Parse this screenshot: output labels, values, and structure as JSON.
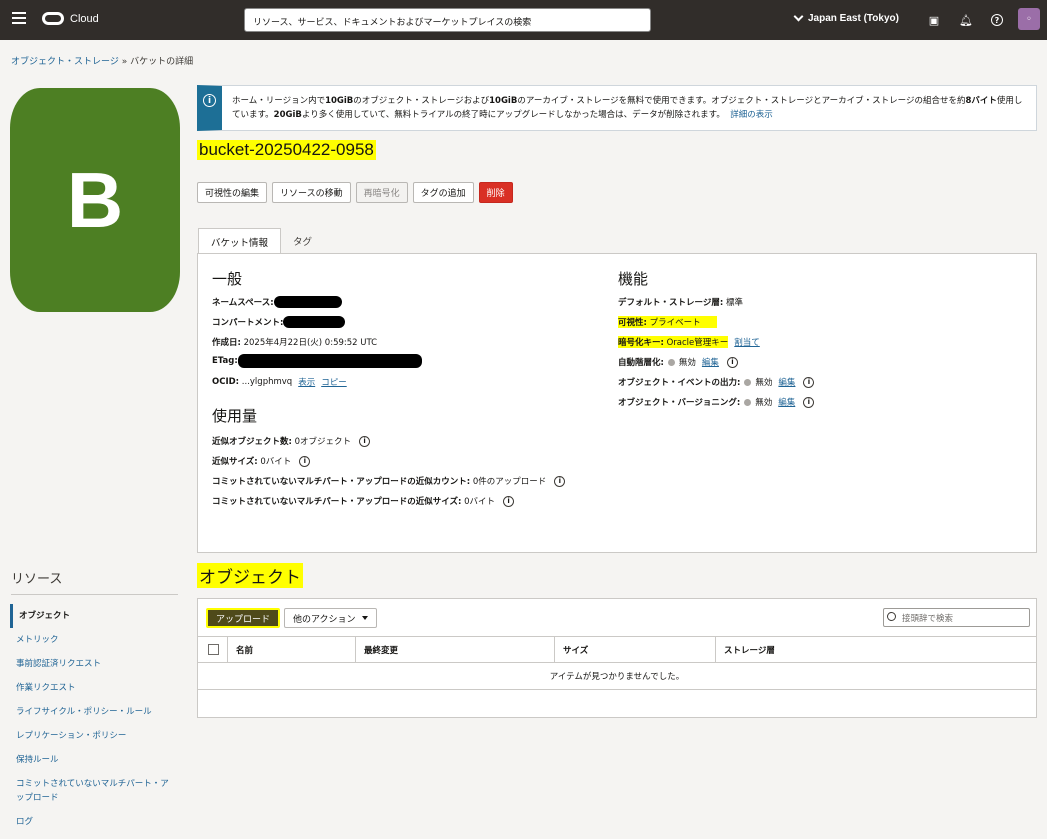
{
  "topbar": {
    "brand": "Cloud",
    "search_placeholder": "リソース、サービス、ドキュメントおよびマーケットプレイスの検索",
    "region": "Japan East (Tokyo)"
  },
  "breadcrumb": {
    "parent": "オブジェクト・ストレージ",
    "separator": "»",
    "current": "バケットの詳細"
  },
  "bucket_icon_letter": "B",
  "banner": {
    "text1": "ホーム・リージョン内で",
    "b1": "10GiB",
    "text2": "のオブジェクト・ストレージおよび",
    "b2": "10GiB",
    "text3": "のアーカイブ・ストレージを無料で使用できます。オブジェクト・ストレージとアーカイブ・ストレージの組合せを約",
    "b3": "8バイト",
    "text4": "使用しています。",
    "b4": "20GiB",
    "text5": "より多く使用していて、無料トライアルの終了時にアップグレードしなかった場合は、データが削除されます。",
    "link": "詳細の表示"
  },
  "title": "bucket-20250422-0958",
  "buttons": {
    "edit_visibility": "可視性の編集",
    "move_resource": "リソースの移動",
    "reencrypt": "再暗号化",
    "add_tags": "タグの追加",
    "delete": "削除"
  },
  "tabs": {
    "bucket_info": "バケット情報",
    "tags": "タグ"
  },
  "general": {
    "heading": "一般",
    "namespace_label": "ネームスペース:",
    "compartment_label": "コンパートメント:",
    "created_label": "作成日:",
    "created_value": "2025年4月22日(火) 0:59:52 UTC",
    "etag_label": "ETag:",
    "ocid_label": "OCID:",
    "ocid_value": "...ylgphmvq",
    "show": "表示",
    "copy": "コピー"
  },
  "usage": {
    "heading": "使用量",
    "obj_count_label": "近似オブジェクト数:",
    "obj_count_value": "0オブジェクト",
    "size_label": "近似サイズ:",
    "size_value": "0バイト",
    "mp_count_label": "コミットされていないマルチパート・アップロードの近似カウント:",
    "mp_count_value": "0件のアップロード",
    "mp_size_label": "コミットされていないマルチパート・アップロードの近似サイズ:",
    "mp_size_value": "0バイト"
  },
  "features": {
    "heading": "機能",
    "storage_tier_label": "デフォルト・ストレージ層:",
    "storage_tier_value": "標準",
    "visibility_label": "可視性:",
    "visibility_value": "プライベート",
    "encryption_label": "暗号化キー:",
    "encryption_value": "Oracle管理キー",
    "assign": "割当て",
    "auto_tier_label": "自動階層化:",
    "events_label": "オブジェクト・イベントの出力:",
    "versioning_label": "オブジェクト・バージョニング:",
    "disabled": "無効",
    "edit": "編集"
  },
  "objects": {
    "heading": "オブジェクト",
    "upload": "アップロード",
    "more_actions": "他のアクション",
    "search_placeholder": "接頭辞で検索",
    "columns": [
      "名前",
      "最終変更",
      "サイズ",
      "ストレージ層"
    ],
    "empty": "アイテムが見つかりませんでした。"
  },
  "resources": {
    "heading": "リソース",
    "items": [
      "オブジェクト",
      "メトリック",
      "事前認証済リクエスト",
      "作業リクエスト",
      "ライフサイクル・ポリシー・ルール",
      "レプリケーション・ポリシー",
      "保持ルール",
      "コミットされていないマルチパート・アップロード",
      "ログ"
    ]
  }
}
